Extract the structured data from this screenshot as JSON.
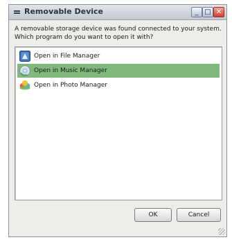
{
  "window": {
    "title": "Removable Device",
    "minimize_glyph": "_",
    "maximize_glyph": "□",
    "close_glyph": "✕"
  },
  "dialog": {
    "prompt": "A removable storage device was found connected to your system. Which program do you want to open it with?",
    "options": [
      {
        "label": "Open in File Manager",
        "icon": "file-manager-icon",
        "selected": false
      },
      {
        "label": "Open in Music Manager",
        "icon": "music-manager-icon",
        "selected": true
      },
      {
        "label": "Open in Photo Manager",
        "icon": "photo-manager-icon",
        "selected": false
      }
    ],
    "ok_label": "OK",
    "cancel_label": "Cancel"
  },
  "colors": {
    "selection": "#7fb97b",
    "titlebar": "#c3c8d1",
    "window_bg": "#eeedea"
  }
}
